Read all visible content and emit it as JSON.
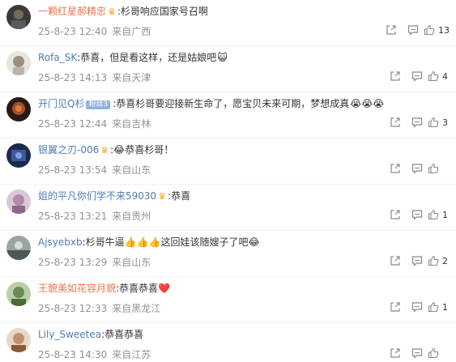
{
  "comments": [
    {
      "user": "一颗红星郝精忠",
      "crown": true,
      "text": ":杉哥响应国家号召啊",
      "time": "25-8-23 12:40",
      "source": "来自广西",
      "likes": "13"
    },
    {
      "user": "Rofa_SK",
      "text": ":恭喜，但是看这样，还是姑娘吧",
      "emoji_after": "😺",
      "time": "25-8-23 14:13",
      "source": "来自天津",
      "likes": "4"
    },
    {
      "user": "开门见Q杉",
      "tag": "粉丝3",
      "text": ":恭喜杉哥要迎接新生命了，愿宝贝未来可期，梦想成真",
      "emoji_after": "😭😭😭",
      "time": "25-8-23 12:44",
      "source": "来自吉林",
      "likes": "3"
    },
    {
      "user": "银翼之刃-006",
      "crown": true,
      "text": ":😂恭喜杉哥！",
      "time": "25-8-23 13:54",
      "source": "来自山东",
      "likes": ""
    },
    {
      "user": "姐的平凡你们学不来59030",
      "crown": true,
      "text": ":恭喜",
      "time": "25-8-23 13:21",
      "source": "来自贵州",
      "likes": "1"
    },
    {
      "user": "Ajsyebxb",
      "text": ":杉哥牛逼👍👍👍这回娃该随嫂子了吧😂",
      "time": "25-8-23 13:29",
      "source": "来自山东",
      "likes": "2"
    },
    {
      "user": "王貌美如花容月貌",
      "text": ":恭喜恭喜❤️",
      "time": "25-8-23 12:33",
      "source": "来自黑龙江",
      "likes": "1"
    },
    {
      "user": "Lily_Sweetea",
      "text": ":恭喜恭喜",
      "time": "25-8-23 14:30",
      "source": "来自江苏",
      "likes": ""
    }
  ],
  "colors": {
    "username": "#eb7350",
    "username_alt": "#507daf",
    "meta": "#939393",
    "icon": "#8a8a8a"
  },
  "icons": {
    "share": "share-icon",
    "comment": "comment-icon",
    "like": "like-icon",
    "crown": "crown-icon"
  }
}
